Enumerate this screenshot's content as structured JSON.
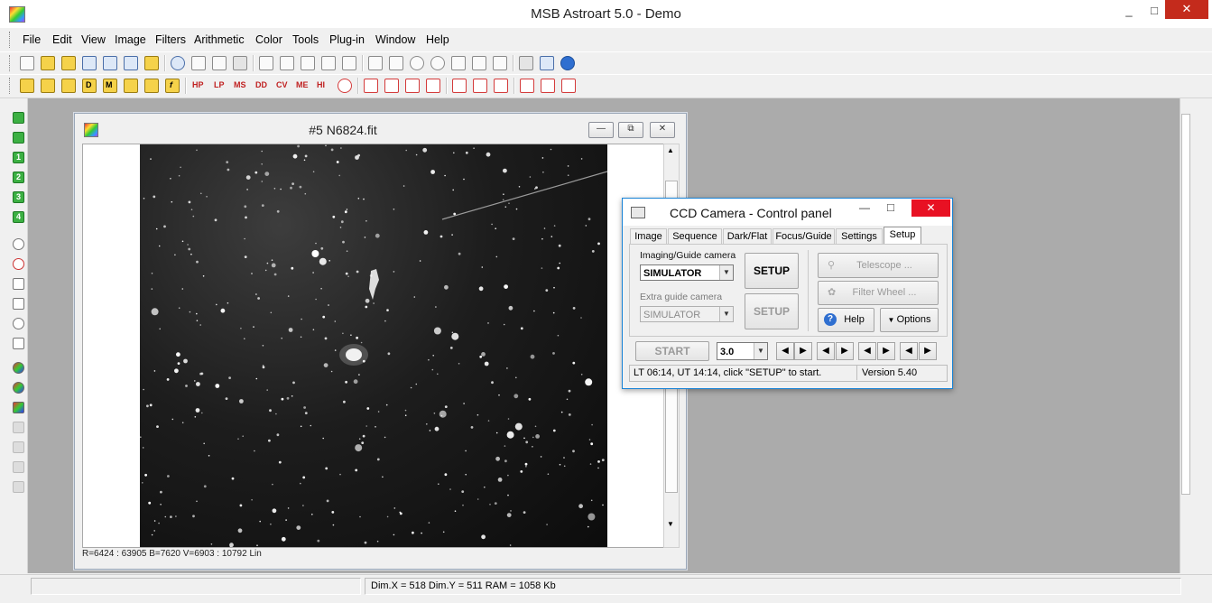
{
  "app": {
    "title": "MSB Astroart 5.0 - Demo",
    "window_controls": [
      "_",
      "□",
      "✕"
    ]
  },
  "menu": [
    "File",
    "Edit",
    "View",
    "Image",
    "Filters",
    "Arithmetic",
    "Color",
    "Tools",
    "Plug-in",
    "Window",
    "Help"
  ],
  "toolbar2_labels": [
    "HP",
    "LP",
    "MS",
    "DD",
    "CV",
    "ME",
    "HI"
  ],
  "toolbar2_left_labels": [
    "D",
    "M",
    "f"
  ],
  "left_toolbar_digits": [
    "1",
    "2",
    "3",
    "4"
  ],
  "image_window": {
    "title": "#5 N6824.fit",
    "controls": [
      "—",
      "⧉",
      "✕"
    ],
    "status": "R=6424 : 63905   B=7620   V=6903 : 10792 Lin",
    "scroll_up": "▲",
    "scroll_down": "▼"
  },
  "ccd_panel": {
    "title": "CCD Camera - Control panel",
    "close": "✕",
    "minimize": "—",
    "maximize": "□",
    "tabs": [
      "Image",
      "Sequence",
      "Dark/Flat",
      "Focus/Guide",
      "Settings",
      "Setup"
    ],
    "selected_tab": "Setup",
    "imaging_label": "Imaging/Guide camera",
    "imaging_value": "SIMULATOR",
    "extra_label": "Extra guide camera",
    "extra_value": "SIMULATOR",
    "setup_label": "SETUP",
    "setup2_label": "SETUP",
    "telescope_label": "Telescope ...",
    "filter_label": "Filter Wheel ...",
    "help_label": "Help",
    "options_label": "Options",
    "start_label": "START",
    "exposure_value": "3.0",
    "status_text": "LT 06:14,  UT 14:14,  click \"SETUP\" to start.",
    "version": "Version 5.40"
  },
  "statusbar": {
    "dims": "Dim.X = 518   Dim.Y = 511   RAM = 1058 Kb"
  },
  "colors": {
    "ccd_close": "#e81123",
    "app_close": "#c42b1c",
    "workspace": "#ababab",
    "accent_border": "#1883d7"
  }
}
